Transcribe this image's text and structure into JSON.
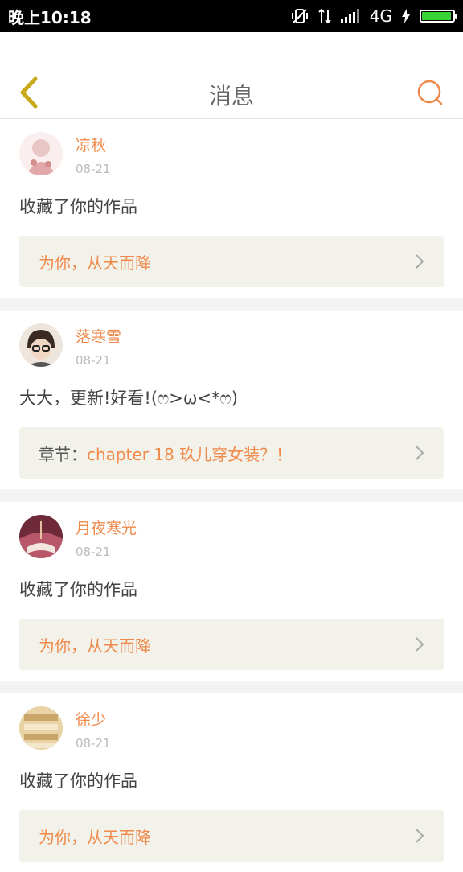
{
  "status": {
    "time": "晚上10:18",
    "network": "4G"
  },
  "header": {
    "title": "消息"
  },
  "messages": [
    {
      "username": "凉秋",
      "date": "08-21",
      "text": "收藏了你的作品",
      "ref_prefix": "",
      "ref_text": "为你，从天而降",
      "avatar_color": "#e9c6c6"
    },
    {
      "username": "落寒雪",
      "date": "08-21",
      "text": "大大，更新!好看!(ෆ>ω<*ෆ)",
      "ref_prefix": "章节：",
      "ref_text": "chapter 18 玖儿穿女装？！",
      "avatar_color": "#3a2a24"
    },
    {
      "username": "月夜寒光",
      "date": "08-21",
      "text": "收藏了你的作品",
      "ref_prefix": "",
      "ref_text": "为你，从天而降",
      "avatar_color": "#9b3a4a"
    },
    {
      "username": "徐少",
      "date": "08-21",
      "text": "收藏了你的作品",
      "ref_prefix": "",
      "ref_text": "为你，从天而降",
      "avatar_color": "#d9b87a"
    }
  ],
  "colors": {
    "accent": "#f08a4b",
    "back_icon": "#c9a81a",
    "battery": "#39d338"
  }
}
